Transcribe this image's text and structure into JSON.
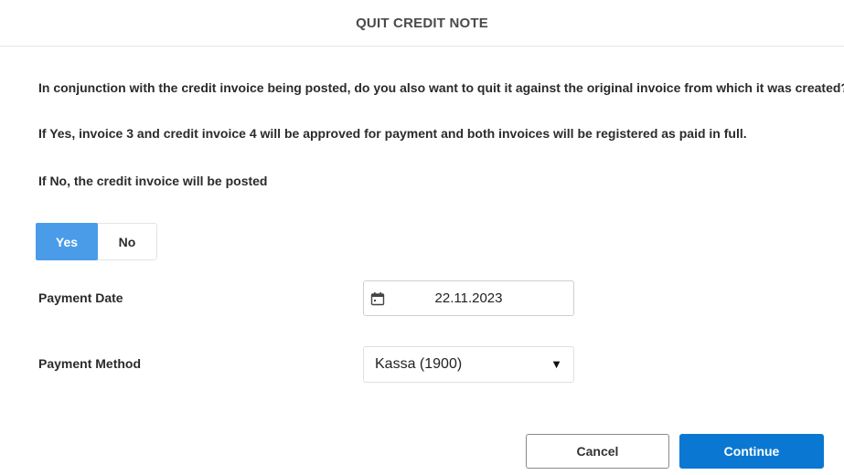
{
  "dialog": {
    "title": "QUIT CREDIT NOTE",
    "messages": [
      "In conjunction with the credit invoice being posted, do you also want to quit it against the original invoice from which it was created?",
      "If Yes, invoice 3 and credit invoice 4 will be approved for payment and both invoices will be registered as paid in full.",
      "If No, the credit invoice will be posted"
    ],
    "toggle": {
      "yes_label": "Yes",
      "no_label": "No",
      "selected": "Yes"
    },
    "payment_date": {
      "label": "Payment Date",
      "value": "22.11.2023",
      "icon": "calendar-icon"
    },
    "payment_method": {
      "label": "Payment Method",
      "value": "Kassa (1900)",
      "caret": "▼"
    },
    "buttons": {
      "cancel_label": "Cancel",
      "continue_label": "Continue"
    },
    "colors": {
      "toggle_selected": "#4a9ce8",
      "primary_button": "#0a78d2"
    }
  }
}
